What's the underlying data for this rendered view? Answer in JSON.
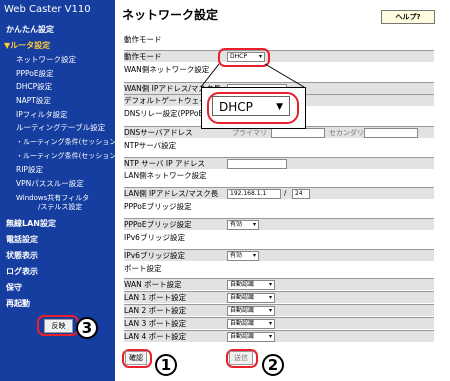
{
  "sidebar": {
    "title": "Web Caster V110",
    "items": [
      {
        "label": "かんたん設定"
      },
      {
        "label": "▼ルータ設定"
      },
      {
        "label": "ネットワーク設定"
      },
      {
        "label": "PPPoE設定"
      },
      {
        "label": "DHCP設定"
      },
      {
        "label": "NAPT設定"
      },
      {
        "label": "IPフィルタ設定"
      },
      {
        "label": "ルーティングテーブル設定"
      },
      {
        "label": "・ルーティング条件(セッション1)"
      },
      {
        "label": "・ルーティング条件(セッション2)"
      },
      {
        "label": "RIP設定"
      },
      {
        "label": "VPNパススルー設定"
      },
      {
        "label": "Windows共有フィルタ"
      },
      {
        "label": "/ステルス設定"
      },
      {
        "label": "無線LAN設定"
      },
      {
        "label": "電話設定"
      },
      {
        "label": "状態表示"
      },
      {
        "label": "ログ表示"
      },
      {
        "label": "保守"
      },
      {
        "label": "再起動"
      }
    ],
    "reflect_label": "反映"
  },
  "header": {
    "title": "ネットワーク設定",
    "help_label": "ヘルプ?"
  },
  "form": {
    "sec_mode": "動作モード",
    "mode_label": "動作モード",
    "mode_value": "DHCP",
    "sec_wan": "WAN側ネットワーク設定",
    "wan_ip_label": "WAN側 IPアドレス/マスク長",
    "gateway_label": "デフォルトゲートウェイ",
    "sec_dns": "DNSリレー設定(PPPoE)",
    "dns_label": "DNSサーバアドレス",
    "dns_primary": "プライマリ",
    "dns_secondary": "セカンダリ",
    "sec_ntp": "NTPサーバ設定",
    "ntp_label": "NTP サーバ IP アドレス",
    "sec_lan": "LAN側ネットワーク設定",
    "lan_ip_label": "LAN側 IPアドレス/マスク長",
    "lan_ip_value": "192.168.1.1",
    "lan_slash": "/",
    "lan_mask_value": "24",
    "sec_pppoe_bridge": "PPPoEブリッジ設定",
    "pppoe_bridge_label": "PPPoEブリッジ設定",
    "pppoe_bridge_value": "有効",
    "sec_ipv6_bridge": "IPv6ブリッジ設定",
    "ipv6_bridge_label": "IPv6ブリッジ設定",
    "ipv6_bridge_value": "有効",
    "sec_port": "ポート設定",
    "ports": [
      {
        "label": "WAN ポート設定",
        "value": "自動認識"
      },
      {
        "label": "LAN 1 ポート設定",
        "value": "自動認識"
      },
      {
        "label": "LAN 2 ポート設定",
        "value": "自動認識"
      },
      {
        "label": "LAN 3 ポート設定",
        "value": "自動認識"
      },
      {
        "label": "LAN 4 ポート設定",
        "value": "自動認識"
      }
    ],
    "confirm_label": "確認",
    "send_label": "送信"
  },
  "zoom": {
    "value": "DHCP"
  },
  "annotations": {
    "n1": "1",
    "n2": "2",
    "n3": "3"
  },
  "colors": {
    "sidebar_bg": "#163ea0",
    "active_item": "#ffcc33",
    "highlight": "#e8202a",
    "row_bg": "#e2e2e2"
  }
}
